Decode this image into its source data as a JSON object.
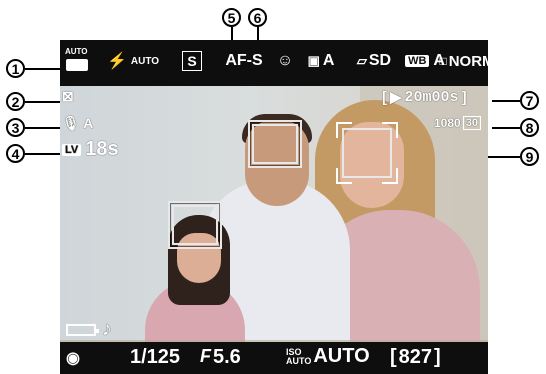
{
  "callouts": [
    "1",
    "2",
    "3",
    "4",
    "5",
    "6",
    "7",
    "8",
    "9"
  ],
  "topbar": {
    "mode_badge": "AUTO",
    "flash": "AUTO",
    "release_mode": "S",
    "af_mode": "AF-S",
    "scene": "A",
    "picture_control": "SD",
    "white_balance": "A",
    "image_quality": "NORM"
  },
  "left": {
    "mic_label": "A",
    "lv_time": "18s"
  },
  "right": {
    "movie_time": "20m00s",
    "movie_size": "1080",
    "frame_rate": "30"
  },
  "bottombar": {
    "shutter": "1/125",
    "aperture_prefix": "F",
    "aperture": "5.6",
    "iso_top": "ISO",
    "iso_bottom": "AUTO",
    "iso_value": "AUTO",
    "remaining": "827"
  },
  "colors": {
    "osd_text": "#ffffff",
    "bars": "#0e0e0e",
    "callout_ring": "#000000"
  }
}
